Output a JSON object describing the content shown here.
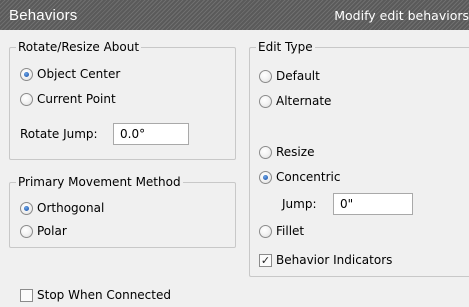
{
  "header": {
    "title": "Behaviors",
    "subtitle": "Modify edit behaviors"
  },
  "rotate_resize": {
    "legend": "Rotate/Resize About",
    "options": [
      {
        "label": "Object Center",
        "checked": true
      },
      {
        "label": "Current Point",
        "checked": false
      }
    ],
    "rotate_jump": {
      "label": "Rotate Jump:",
      "value": "0.0°"
    }
  },
  "primary_movement": {
    "legend": "Primary Movement Method",
    "options": [
      {
        "label": "Orthogonal",
        "checked": true
      },
      {
        "label": "Polar",
        "checked": false
      }
    ]
  },
  "edit_type": {
    "legend": "Edit Type",
    "options": [
      {
        "label": "Default",
        "checked": false
      },
      {
        "label": "Alternate",
        "checked": false
      },
      {
        "label": "Resize",
        "checked": false
      },
      {
        "label": "Concentric",
        "checked": true
      },
      {
        "label": "Fillet",
        "checked": false
      }
    ],
    "jump": {
      "label": "Jump:",
      "value": "0\""
    },
    "behavior_indicators": {
      "label": "Behavior Indicators",
      "checked": true
    }
  },
  "stop_when_connected": {
    "label": "Stop When Connected",
    "checked": false
  }
}
